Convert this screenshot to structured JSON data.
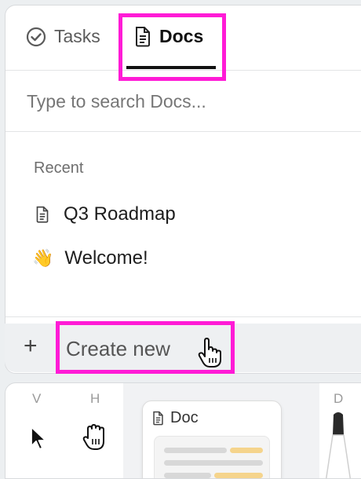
{
  "tabs": [
    {
      "label": "Tasks",
      "icon": "check-circle-icon",
      "active": false
    },
    {
      "label": "Docs",
      "icon": "document-icon",
      "active": true
    }
  ],
  "search": {
    "placeholder": "Type to search Docs..."
  },
  "recent": {
    "label": "Recent",
    "items": [
      {
        "label": "Q3 Roadmap",
        "icon": "document-icon"
      },
      {
        "label": "Welcome!",
        "icon": "👋"
      }
    ]
  },
  "create": {
    "label": "Create new",
    "icon": "plus-icon"
  },
  "toolbar": {
    "tools": [
      {
        "key": "V",
        "icon": "cursor-arrow-icon"
      },
      {
        "key": "H",
        "icon": "hand-icon"
      },
      {
        "key": "D",
        "icon": "pen-icon"
      }
    ],
    "doc_card": {
      "label": "Doc"
    }
  },
  "colors": {
    "highlight": "#ff1bd6",
    "accent_bar": "#f5d48c",
    "text": "#1f1f1f"
  }
}
